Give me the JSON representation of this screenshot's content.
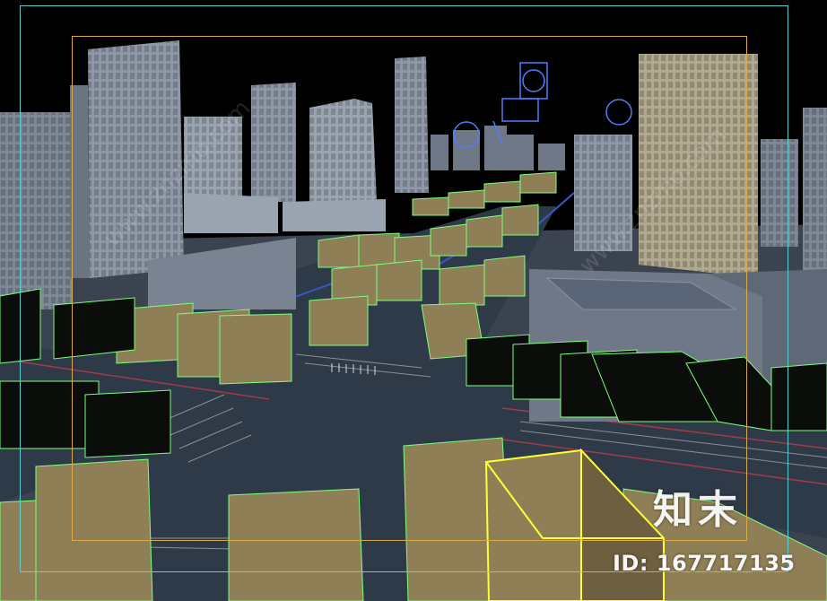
{
  "viewport": {
    "description_label": "",
    "colors": {
      "background": "#000000",
      "safe_frame": "#5fd0d0",
      "render_frame": "#d9a94a",
      "wireframe_green": "#7dff7d",
      "selection_yellow": "#ffff33",
      "building_box": "#8f7f56",
      "road": "#2f3a49",
      "tower": "#8e97a6",
      "blue_wire": "#4f7dff"
    }
  },
  "watermark": {
    "logo": "知末",
    "id_text": "ID: 167717135",
    "diagonal_text": "www.znzmo.com"
  }
}
